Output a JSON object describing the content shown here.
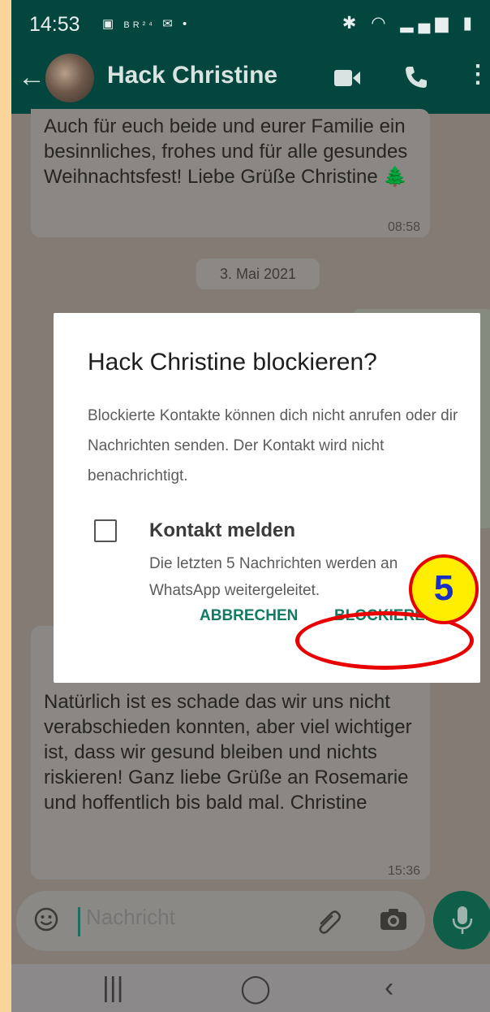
{
  "status_bar": {
    "time": "14:53",
    "notification_icons": [
      "gallery-icon",
      "br24-icon",
      "mail-icon",
      "dot"
    ],
    "system_icons": [
      "bluetooth-icon",
      "wifi-icon",
      "signal-icon",
      "battery-icon"
    ]
  },
  "app_bar": {
    "contact_name": "Hack Christine",
    "actions": [
      "video-call-icon",
      "voice-call-icon",
      "more-icon"
    ]
  },
  "chat": {
    "message1_text": "Auch für euch beide und eurer Familie ein besinnliches, frohes und für alle gesundes Weihnachtsfest! Liebe Grüße Christine 🌲",
    "message1_time": "08:58",
    "date_chip": "3. Mai 2021",
    "message2_text": "Natürlich ist es schade das wir uns nicht verabschieden konnten, aber viel wichtiger ist, dass wir gesund bleiben und nichts riskieren! Ganz liebe Grüße an Rosemarie und hoffentlich bis bald mal. Christine",
    "message2_time": "15:36"
  },
  "input": {
    "placeholder": "Nachricht"
  },
  "dialog": {
    "title": "Hack Christine blockieren?",
    "body": "Blockierte Kontakte können dich nicht anrufen oder dir Nachrichten senden. Der Kontakt wird nicht benachrichtigt.",
    "checkbox_label": "Kontakt melden",
    "checkbox_desc": "Die letzten 5 Nachrichten werden an WhatsApp weitergeleitet.",
    "checkbox_checked": false,
    "cancel_label": "ABBRECHEN",
    "confirm_label": "BLOCKIEREN"
  },
  "annotation": {
    "step_number": "5",
    "ring_color": "#e80000",
    "badge_color": "#ffee00",
    "number_color": "#1b2fc2"
  },
  "colors": {
    "header": "#03463e",
    "accent_button": "#117a63",
    "mic_button": "#0e5e48",
    "frame": "#f9d59c"
  }
}
